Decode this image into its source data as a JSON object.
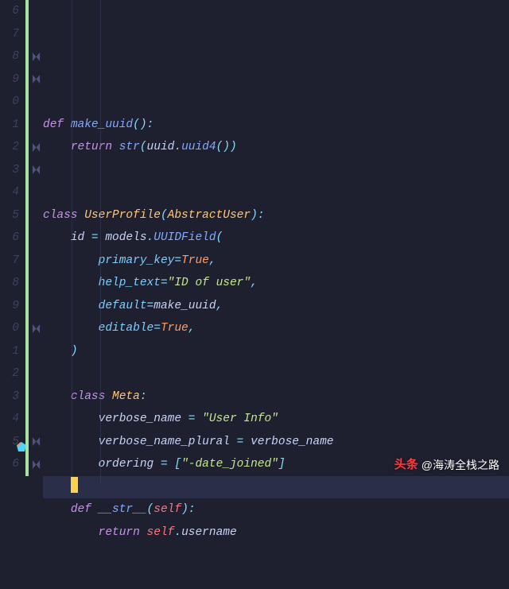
{
  "lineNumbers": [
    "6",
    "7",
    "8",
    "9",
    "0",
    "1",
    "2",
    "3",
    "4",
    "5",
    "6",
    "7",
    "8",
    "9",
    "0",
    "1",
    "2",
    "3",
    "4",
    "5",
    "6"
  ],
  "diffAdded": [
    0,
    1,
    2,
    3,
    4,
    5,
    6,
    7,
    8,
    9,
    10,
    11,
    12,
    13,
    14,
    15,
    16,
    17,
    18,
    19,
    20
  ],
  "folds": {
    "2": "down",
    "3": "down",
    "6": "down",
    "7": "down",
    "14": "down",
    "19": "down",
    "20": "down"
  },
  "cursorLine": 18,
  "code": {
    "l2_def": "def",
    "l2_fn": "make_uuid",
    "l3_return": "return",
    "l3_str": "str",
    "l3_uuid": "uuid",
    "l3_uuid4": "uuid4",
    "l6_class": "class",
    "l6_cls": "UserProfile",
    "l6_base": "AbstractUser",
    "l7_id": "id",
    "l7_models": "models",
    "l7_field": "UUIDField",
    "l8_pk": "primary_key",
    "l8_true": "True",
    "l9_ht": "help_text",
    "l9_str": "\"ID of user\"",
    "l10_def": "default",
    "l10_val": "make_uuid",
    "l11_ed": "editable",
    "l11_true": "True",
    "l14_class": "class",
    "l14_meta": "Meta",
    "l15_vn": "verbose_name",
    "l15_str": "\"User Info\"",
    "l16_vnp": "verbose_name_plural",
    "l16_vn": "verbose_name",
    "l17_ord": "ordering",
    "l17_str": "\"-date_joined\"",
    "l19_def": "def",
    "l19_fn": "__str__",
    "l19_self": "self",
    "l20_return": "return",
    "l20_self": "self",
    "l20_user": "username"
  },
  "watermark": {
    "brand": "头条",
    "handle": "@海涛全栈之路"
  }
}
